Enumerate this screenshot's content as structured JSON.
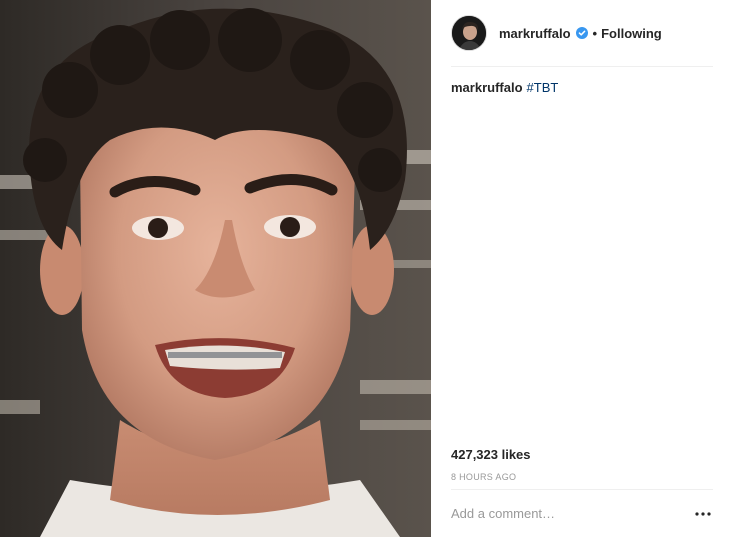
{
  "post": {
    "photo_alt": "",
    "header": {
      "username": "markruffalo",
      "verified": true,
      "separator": "•",
      "follow_status": "Following"
    },
    "caption": {
      "username": "markruffalo",
      "hashtag": "#TBT"
    },
    "likes": "427,323 likes",
    "timestamp": "8 HOURS AGO",
    "comment": {
      "placeholder": "Add a comment…",
      "more_icon": "more-options-icon"
    }
  },
  "colors": {
    "text": "#262626",
    "hashtag": "#003569",
    "muted": "#999999",
    "verified_badge": "#3897f0",
    "divider": "#efefef"
  }
}
